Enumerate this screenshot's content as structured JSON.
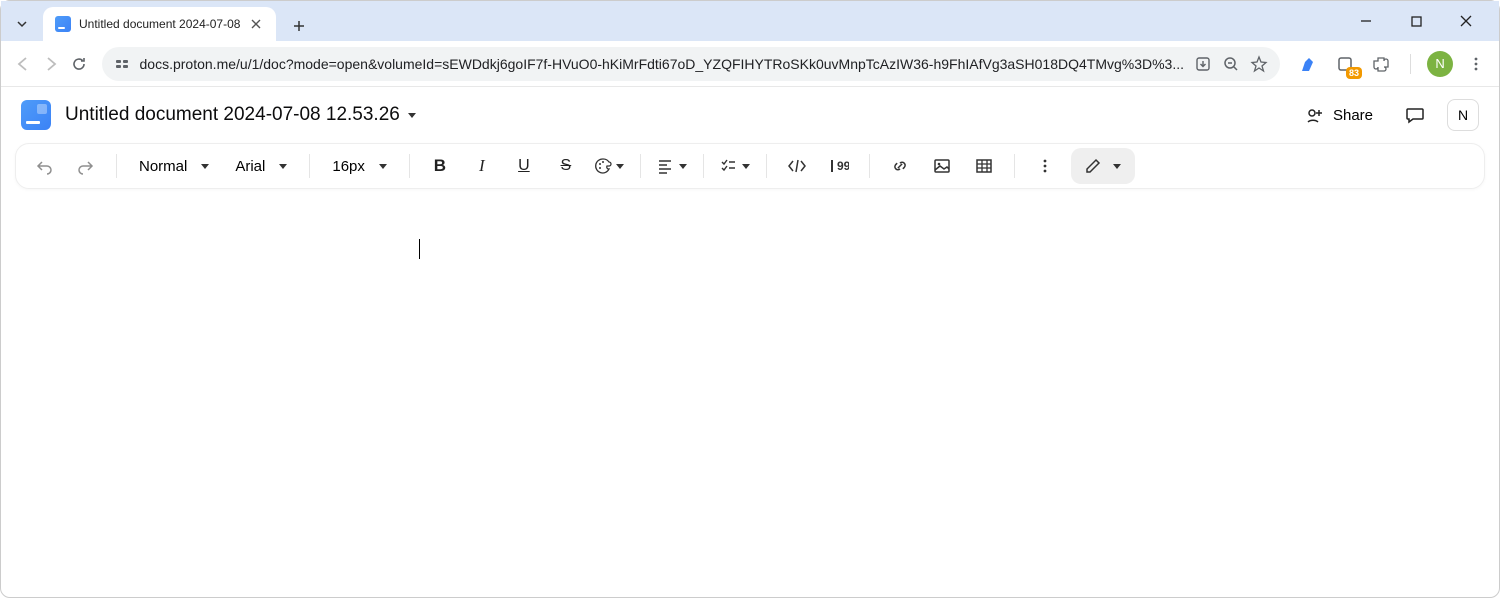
{
  "browser": {
    "tab_title": "Untitled document 2024-07-08",
    "url": "docs.proton.me/u/1/doc?mode=open&volumeId=sEWDdkj6goIF7f-HVuO0-hKiMrFdti67oD_YZQFIHYTRoSKk0uvMnpTcAzIW36-h9FhIAfVg3aSH018DQ4TMvg%3D%3...",
    "ext_badge": "83",
    "profile_initial": "N"
  },
  "header": {
    "doc_title": "Untitled document 2024-07-08 12.53.26",
    "share_label": "Share",
    "user_initial": "N"
  },
  "toolbar": {
    "style_label": "Normal",
    "font_label": "Arial",
    "size_label": "16px"
  }
}
